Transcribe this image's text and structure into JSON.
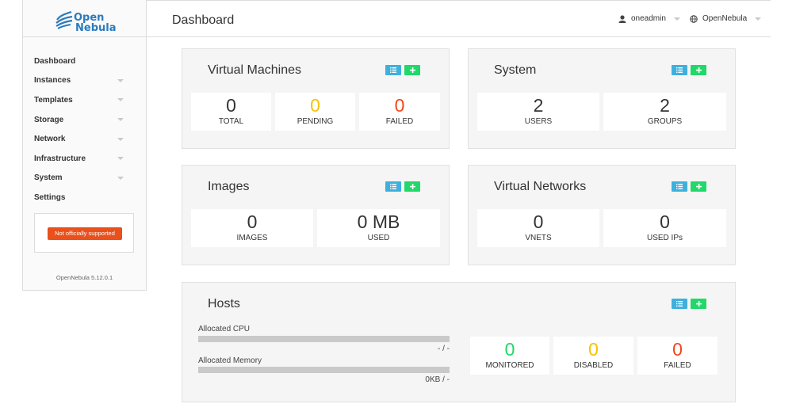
{
  "brand": {
    "line1": "Open",
    "line2": "Nebula"
  },
  "sidebar": {
    "items": [
      {
        "label": "Dashboard",
        "caret": false
      },
      {
        "label": "Instances",
        "caret": true
      },
      {
        "label": "Templates",
        "caret": true
      },
      {
        "label": "Storage",
        "caret": true
      },
      {
        "label": "Network",
        "caret": true
      },
      {
        "label": "Infrastructure",
        "caret": true
      },
      {
        "label": "System",
        "caret": true
      },
      {
        "label": "Settings",
        "caret": false
      }
    ],
    "support_label": "Not officially supported",
    "version": "OpenNebula 5.12.0.1"
  },
  "header": {
    "title": "Dashboard",
    "user": "oneadmin",
    "zone": "OpenNebula"
  },
  "panels": {
    "vms": {
      "title": "Virtual Machines",
      "total": "0",
      "total_label": "TOTAL",
      "pending": "0",
      "pending_label": "PENDING",
      "failed": "0",
      "failed_label": "FAILED"
    },
    "system": {
      "title": "System",
      "users": "2",
      "users_label": "USERS",
      "groups": "2",
      "groups_label": "GROUPS"
    },
    "images": {
      "title": "Images",
      "images": "0",
      "images_label": "IMAGES",
      "used": "0 MB",
      "used_label": "USED"
    },
    "vnets": {
      "title": "Virtual Networks",
      "vnets": "0",
      "vnets_label": "VNETS",
      "usedips": "0",
      "usedips_label": "USED IPs"
    },
    "hosts": {
      "title": "Hosts",
      "cpu_label": "Allocated CPU",
      "cpu_value": "- / -",
      "mem_label": "Allocated Memory",
      "mem_value": "0KB / -",
      "monitored": "0",
      "monitored_label": "MONITORED",
      "disabled": "0",
      "disabled_label": "DISABLED",
      "failed": "0",
      "failed_label": "FAILED"
    }
  },
  "colors": {
    "accent_blue": "#3fb0de",
    "accent_green": "#21d86a",
    "warn": "#f5c200",
    "error": "#f1461b",
    "support": "#e9501c"
  },
  "icons": {
    "list": "list-icon",
    "add": "plus-icon",
    "user": "user-icon",
    "zone": "globe-icon"
  }
}
